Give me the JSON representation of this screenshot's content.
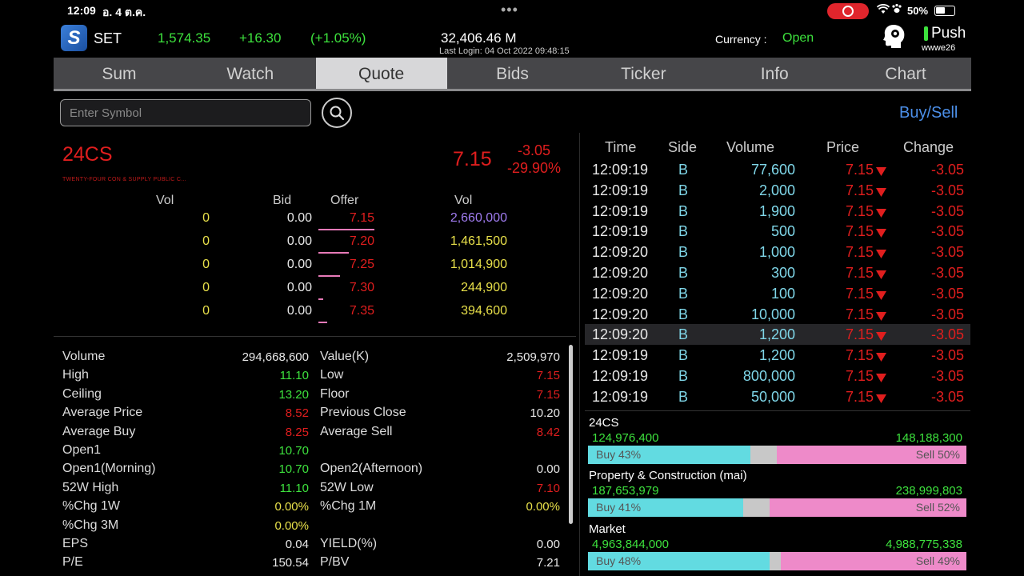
{
  "status": {
    "time": "12:09",
    "date": "อ. 4 ต.ค.",
    "battery": "50%"
  },
  "header": {
    "market": "SET",
    "index_value": "1,574.35",
    "index_change": "+16.30",
    "index_pct": "(+1.05%)",
    "market_value": "32,406.46 M",
    "last_login": "Last Login: 04 Oct 2022 09:48:15",
    "currency_label": "Currency :",
    "currency_value": "Open",
    "push_label": "Push",
    "user_id": "wwwe26"
  },
  "tabs": [
    "Sum",
    "Watch",
    "Quote",
    "Bids",
    "Ticker",
    "Info",
    "Chart"
  ],
  "active_tab": "Quote",
  "search": {
    "placeholder": "Enter Symbol"
  },
  "buysell_label": "Buy/Sell",
  "symbol": {
    "code": "24CS",
    "fullname": "TWENTY-FOUR CON & SUPPLY PUBLIC C...",
    "last": "7.15",
    "change": "-3.05",
    "pct": "-29.90%"
  },
  "bidoffer": {
    "headers": [
      "Vol",
      "Bid",
      "Offer",
      "Vol"
    ],
    "rows": [
      {
        "bid_vol": "0",
        "bid": "0.00",
        "offer": "7.15",
        "offer_vol": "2,660,000",
        "bar": 0.26
      },
      {
        "bid_vol": "0",
        "bid": "0.00",
        "offer": "7.20",
        "offer_vol": "1,461,500",
        "bar": 0.14
      },
      {
        "bid_vol": "0",
        "bid": "0.00",
        "offer": "7.25",
        "offer_vol": "1,014,900",
        "bar": 0.1
      },
      {
        "bid_vol": "0",
        "bid": "0.00",
        "offer": "7.30",
        "offer_vol": "244,900",
        "bar": 0.02
      },
      {
        "bid_vol": "0",
        "bid": "0.00",
        "offer": "7.35",
        "offer_vol": "394,600",
        "bar": 0.04
      }
    ]
  },
  "stats": {
    "left": [
      {
        "label": "Volume",
        "value": "294,668,600",
        "color": "#e8e8e8"
      },
      {
        "label": "High",
        "value": "11.10",
        "color": "#3de13d"
      },
      {
        "label": "Ceiling",
        "value": "13.20",
        "color": "#3de13d"
      },
      {
        "label": "Average Price",
        "value": "8.52",
        "color": "#e01e1e"
      },
      {
        "label": "Average Buy",
        "value": "8.25",
        "color": "#e01e1e"
      },
      {
        "label": "Open1",
        "value": "10.70",
        "color": "#3de13d"
      },
      {
        "label": "Open1(Morning)",
        "value": "10.70",
        "color": "#3de13d"
      },
      {
        "label": "52W High",
        "value": "11.10",
        "color": "#3de13d"
      },
      {
        "label": "%Chg 1W",
        "value": "0.00%",
        "color": "#e8e04a"
      },
      {
        "label": "%Chg 3M",
        "value": "0.00%",
        "color": "#e8e04a"
      },
      {
        "label": "EPS",
        "value": "0.04",
        "color": "#e8e8e8"
      },
      {
        "label": "P/E",
        "value": "150.54",
        "color": "#e8e8e8"
      }
    ],
    "right": [
      {
        "label": "Value(K)",
        "value": "2,509,970",
        "color": "#e8e8e8"
      },
      {
        "label": "Low",
        "value": "7.15",
        "color": "#e01e1e"
      },
      {
        "label": "Floor",
        "value": "7.15",
        "color": "#e01e1e"
      },
      {
        "label": "Previous Close",
        "value": "10.20",
        "color": "#e8e8e8"
      },
      {
        "label": "Average Sell",
        "value": "8.42",
        "color": "#e01e1e"
      },
      {
        "label": "",
        "value": "",
        "color": "#e8e8e8"
      },
      {
        "label": "Open2(Afternoon)",
        "value": "0.00",
        "color": "#e8e8e8"
      },
      {
        "label": "52W Low",
        "value": "7.10",
        "color": "#e01e1e"
      },
      {
        "label": "%Chg 1M",
        "value": "0.00%",
        "color": "#e8e04a"
      },
      {
        "label": "",
        "value": "",
        "color": "#e8e8e8"
      },
      {
        "label": "YIELD(%)",
        "value": "0.00",
        "color": "#e8e8e8"
      },
      {
        "label": "P/BV",
        "value": "7.21",
        "color": "#e8e8e8"
      }
    ]
  },
  "ticker": {
    "headers": [
      "Time",
      "Side",
      "Volume",
      "Price",
      "Change"
    ],
    "rows": [
      {
        "time": "12:09:19",
        "side": "B",
        "volume": "77,600",
        "price": "7.15",
        "change": "-3.05"
      },
      {
        "time": "12:09:19",
        "side": "B",
        "volume": "2,000",
        "price": "7.15",
        "change": "-3.05"
      },
      {
        "time": "12:09:19",
        "side": "B",
        "volume": "1,900",
        "price": "7.15",
        "change": "-3.05"
      },
      {
        "time": "12:09:19",
        "side": "B",
        "volume": "500",
        "price": "7.15",
        "change": "-3.05"
      },
      {
        "time": "12:09:20",
        "side": "B",
        "volume": "1,000",
        "price": "7.15",
        "change": "-3.05"
      },
      {
        "time": "12:09:20",
        "side": "B",
        "volume": "300",
        "price": "7.15",
        "change": "-3.05"
      },
      {
        "time": "12:09:20",
        "side": "B",
        "volume": "100",
        "price": "7.15",
        "change": "-3.05"
      },
      {
        "time": "12:09:20",
        "side": "B",
        "volume": "10,000",
        "price": "7.15",
        "change": "-3.05"
      },
      {
        "time": "12:09:20",
        "side": "B",
        "volume": "1,200",
        "price": "7.15",
        "change": "-3.05"
      },
      {
        "time": "12:09:19",
        "side": "B",
        "volume": "1,200",
        "price": "7.15",
        "change": "-3.05"
      },
      {
        "time": "12:09:19",
        "side": "B",
        "volume": "800,000",
        "price": "7.15",
        "change": "-3.05"
      },
      {
        "time": "12:09:19",
        "side": "B",
        "volume": "50,000",
        "price": "7.15",
        "change": "-3.05"
      }
    ]
  },
  "volume_bars": [
    {
      "label": "24CS",
      "buy_value": "124,976,400",
      "sell_value": "148,188,300",
      "buy_text": "Buy 43%",
      "sell_text": "Sell 50%",
      "buy_frac": 0.43,
      "sell_frac": 0.5
    },
    {
      "label": "Property & Construction (mai)",
      "buy_value": "187,653,979",
      "sell_value": "238,999,803",
      "buy_text": "Buy 41%",
      "sell_text": "Sell 52%",
      "buy_frac": 0.41,
      "sell_frac": 0.52
    },
    {
      "label": "Market",
      "buy_value": "4,963,844,000",
      "sell_value": "4,988,775,338",
      "buy_text": "Buy 48%",
      "sell_text": "Sell 49%",
      "buy_frac": 0.48,
      "sell_frac": 0.49
    }
  ]
}
